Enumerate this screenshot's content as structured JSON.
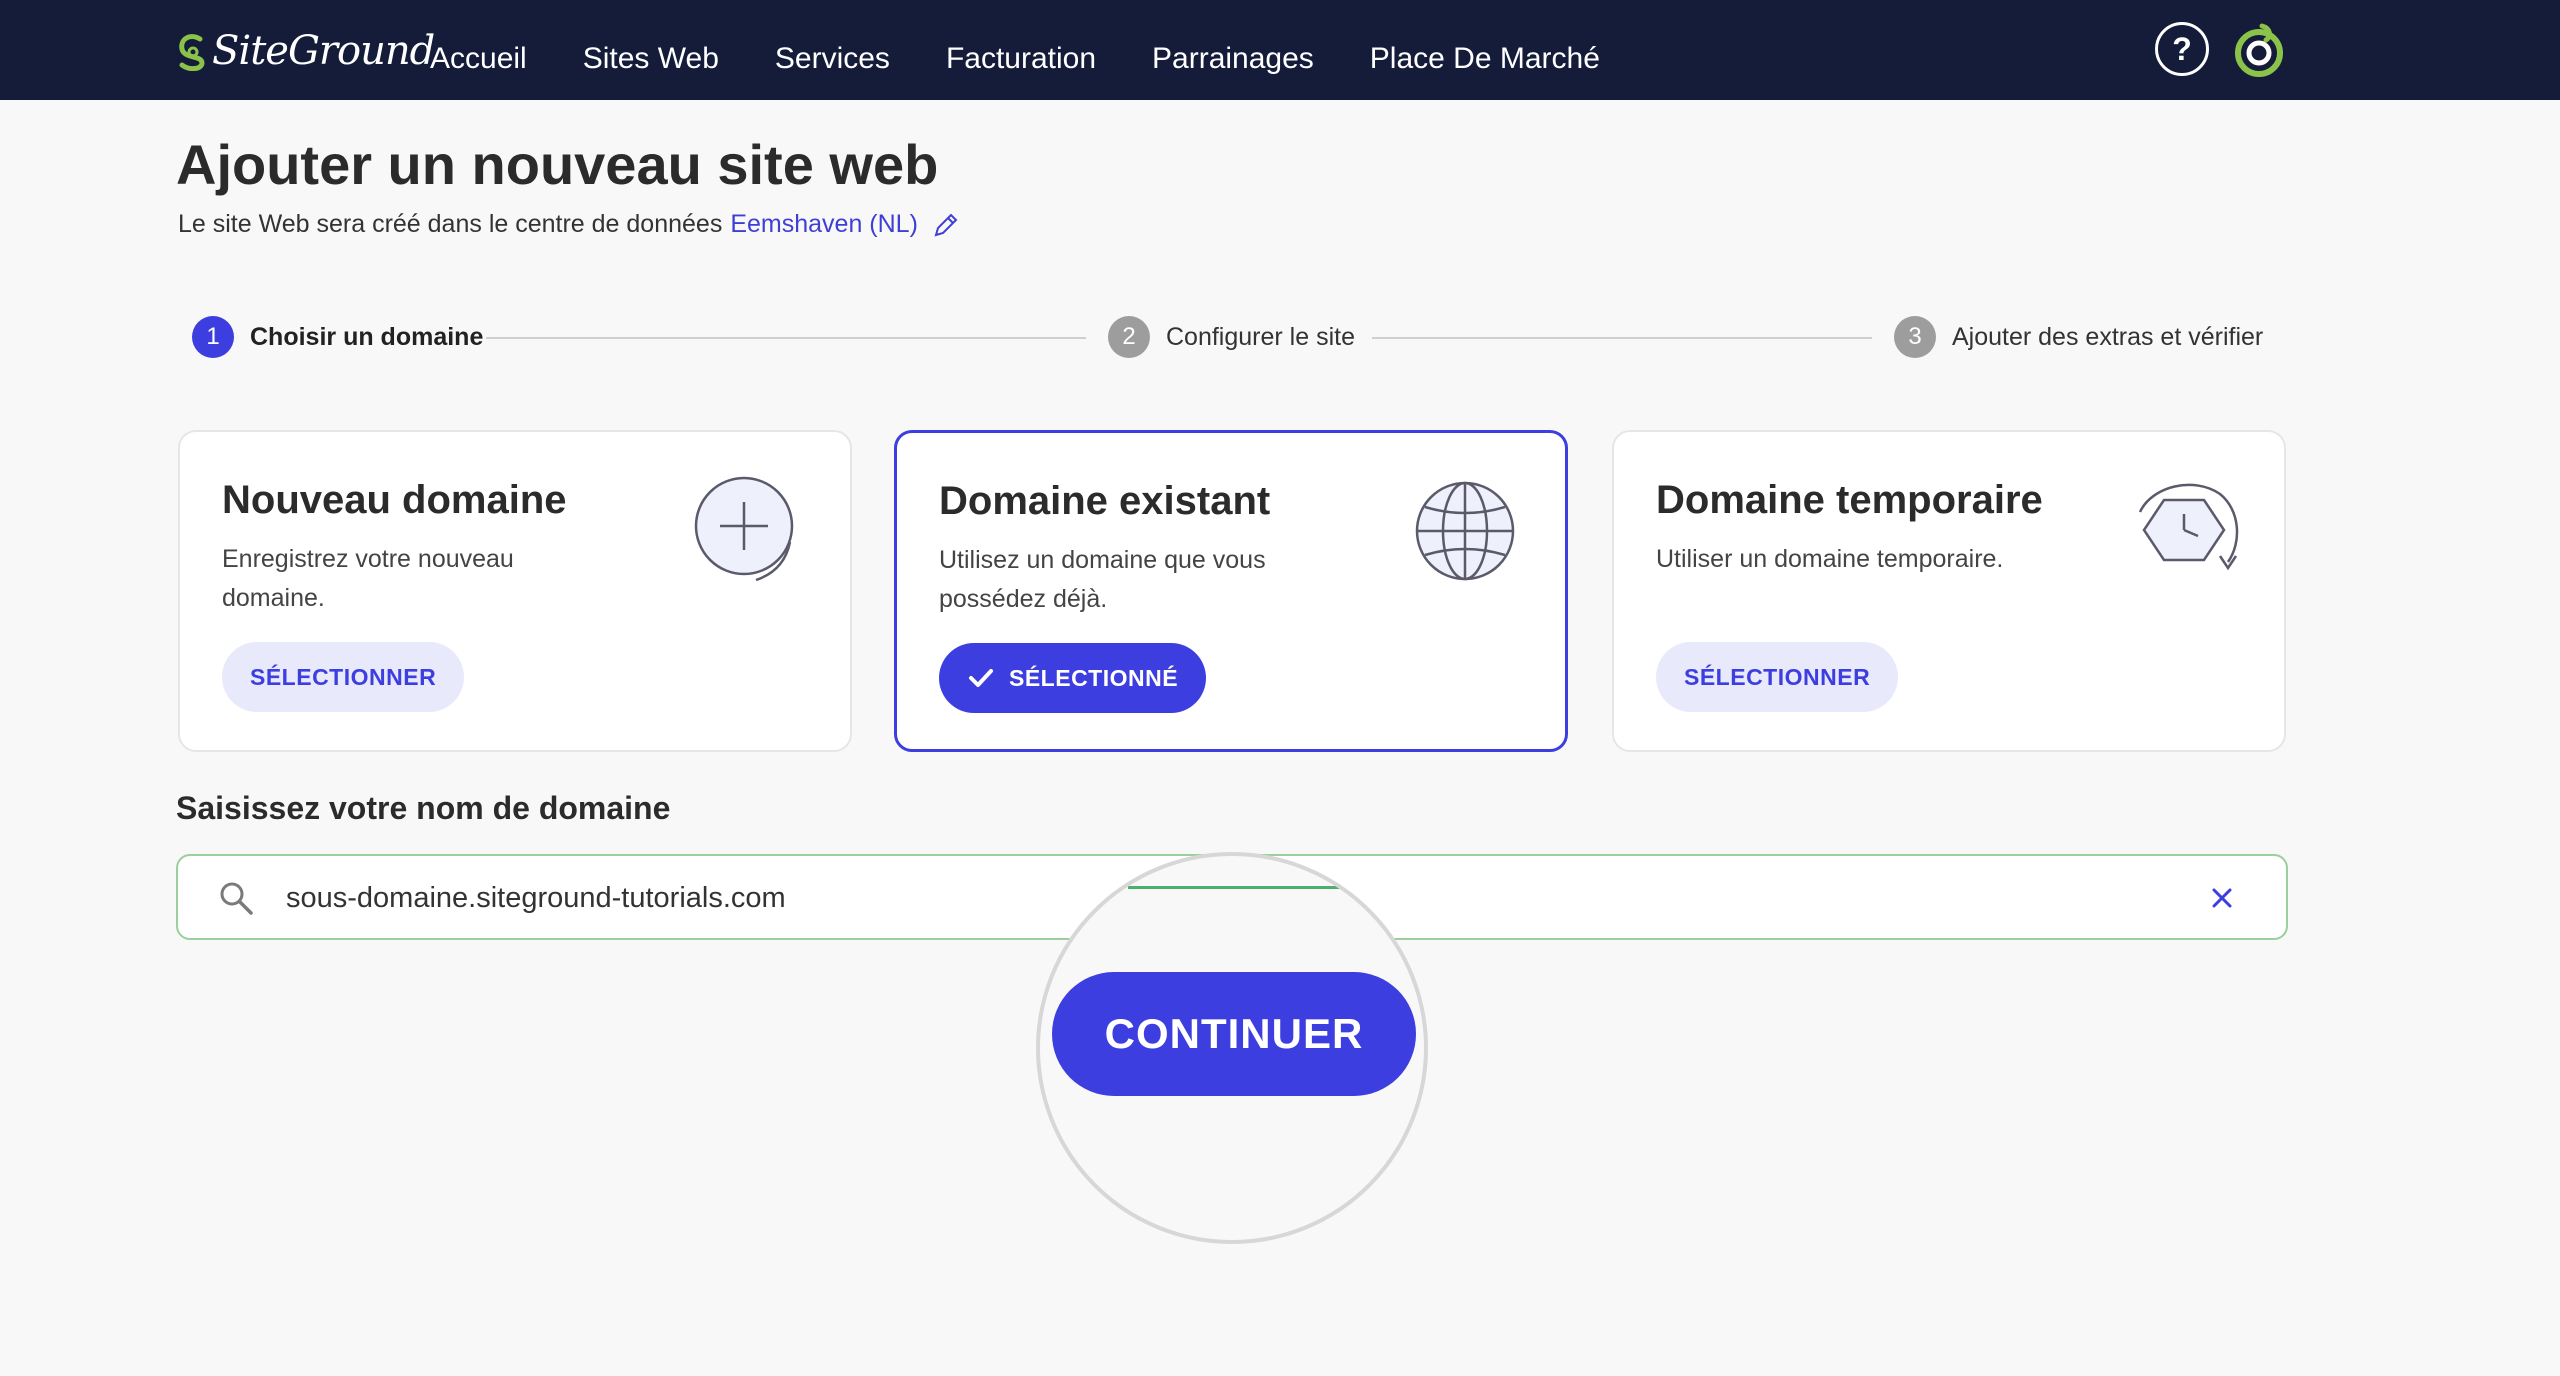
{
  "nav": {
    "logo_text": "SiteGround",
    "items": [
      "Accueil",
      "Sites Web",
      "Services",
      "Facturation",
      "Parrainages",
      "Place De Marché"
    ],
    "help_label": "?"
  },
  "header": {
    "title": "Ajouter un nouveau site web",
    "subtitle_prefix": "Le site Web sera créé dans le centre de données",
    "datacenter": "Eemshaven (NL)"
  },
  "stepper": {
    "steps": [
      {
        "num": "1",
        "label": "Choisir un domaine"
      },
      {
        "num": "2",
        "label": "Configurer le site"
      },
      {
        "num": "3",
        "label": "Ajouter des extras et vérifier"
      }
    ]
  },
  "cards": [
    {
      "title": "Nouveau domaine",
      "desc": "Enregistrez votre nouveau domaine.",
      "button": "SÉLECTIONNER",
      "icon": "plus-circle-icon"
    },
    {
      "title": "Domaine existant",
      "desc": "Utilisez un domaine que vous possédez déjà.",
      "button": "SÉLECTIONNÉ",
      "icon": "globe-icon",
      "selected": true
    },
    {
      "title": "Domaine temporaire",
      "desc": "Utiliser un domaine temporaire.",
      "button": "SÉLECTIONNER",
      "icon": "clock-icon"
    }
  ],
  "domain_field": {
    "label": "Saisissez votre nom de domaine",
    "value": "sous-domaine.siteground-tutorials.com"
  },
  "continue_label": "CONTINUER",
  "colors": {
    "nav_bg": "#141c3a",
    "accent": "#3d3ee0",
    "accent_light": "#e8e9fb",
    "input_border": "#9ccf9c",
    "logo_green": "#8bc34a"
  }
}
